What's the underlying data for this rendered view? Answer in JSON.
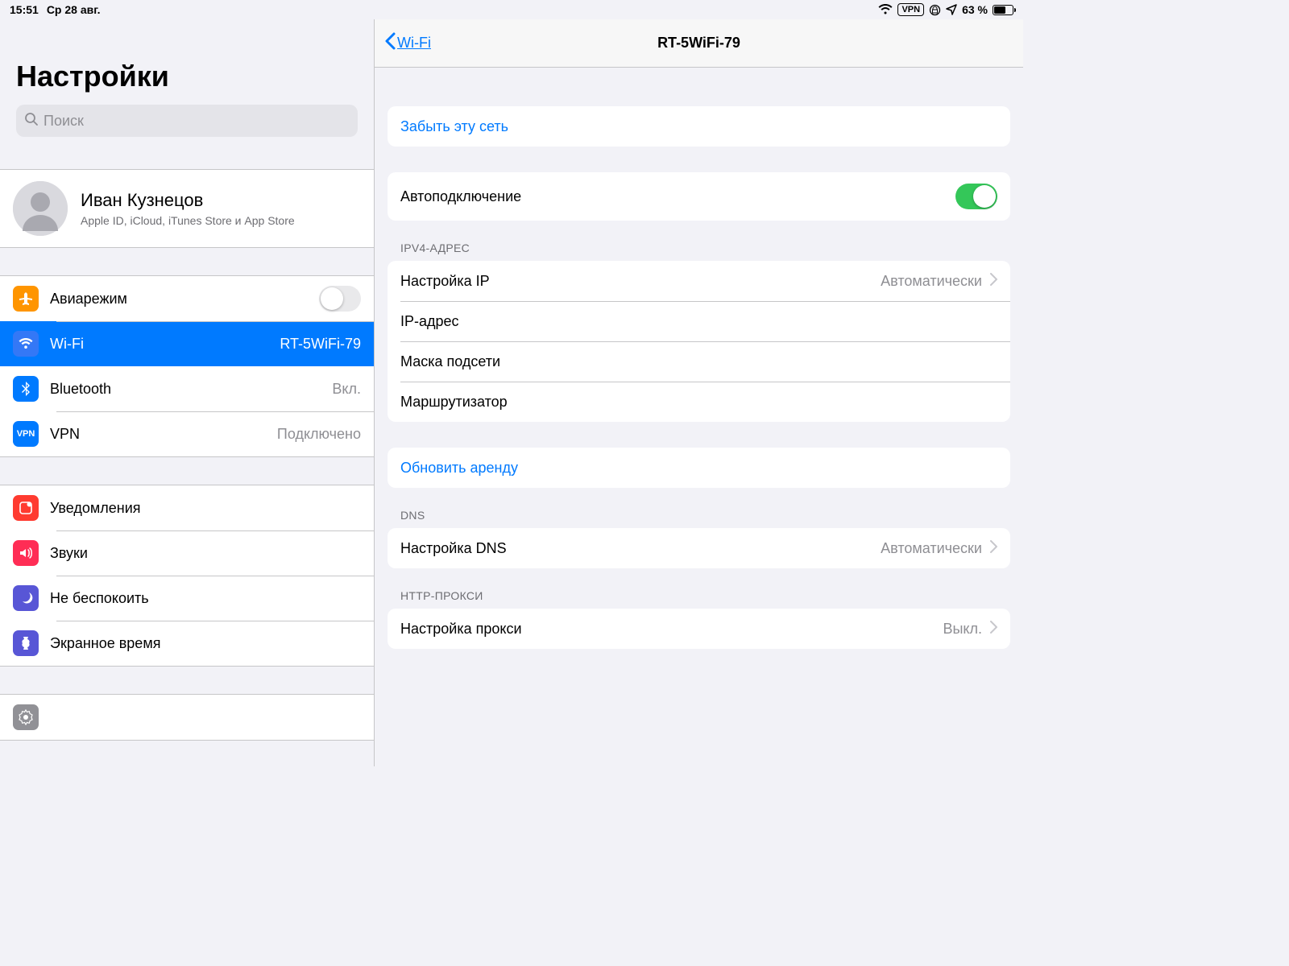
{
  "statusbar": {
    "time": "15:51",
    "date": "Ср 28 авг.",
    "vpn_label": "VPN",
    "battery_percent": "63 %"
  },
  "sidebar": {
    "title": "Настройки",
    "search_placeholder": "Поиск",
    "account": {
      "name": "Иван Кузнецов",
      "subtitle": "Apple ID, iCloud, iTunes Store и App Store"
    },
    "group1": {
      "airplane": {
        "label": "Авиарежим",
        "icon_bg": "#ff9500"
      },
      "wifi": {
        "label": "Wi-Fi",
        "detail": "RT-5WiFi-79",
        "icon_bg": "#007aff"
      },
      "bluetooth": {
        "label": "Bluetooth",
        "detail": "Вкл.",
        "icon_bg": "#007aff"
      },
      "vpn": {
        "label": "VPN",
        "detail": "Подключено",
        "icon_bg": "#007aff",
        "icon_text": "VPN"
      }
    },
    "group2": {
      "notifications": {
        "label": "Уведомления",
        "icon_bg": "#ff3b30"
      },
      "sounds": {
        "label": "Звуки",
        "icon_bg": "#ff2d55"
      },
      "dnd": {
        "label": "Не беспокоить",
        "icon_bg": "#5856d6"
      },
      "screentime": {
        "label": "Экранное время",
        "icon_bg": "#5856d6"
      }
    }
  },
  "detail": {
    "back_label": "Wi-Fi",
    "title": "RT-5WiFi-79",
    "forget": "Забыть эту сеть",
    "autojoin": {
      "label": "Автоподключение",
      "on": true
    },
    "ipv4": {
      "header": "IPV4-АДРЕС",
      "configure_ip": {
        "label": "Настройка IP",
        "value": "Автоматически"
      },
      "ip_address": {
        "label": "IP-адрес"
      },
      "subnet": {
        "label": "Маска подсети"
      },
      "router": {
        "label": "Маршрутизатор"
      }
    },
    "renew_lease": "Обновить аренду",
    "dns": {
      "header": "DNS",
      "configure": {
        "label": "Настройка DNS",
        "value": "Автоматически"
      }
    },
    "proxy": {
      "header": "HTTP-ПРОКСИ",
      "configure": {
        "label": "Настройка прокси",
        "value": "Выкл."
      }
    }
  }
}
